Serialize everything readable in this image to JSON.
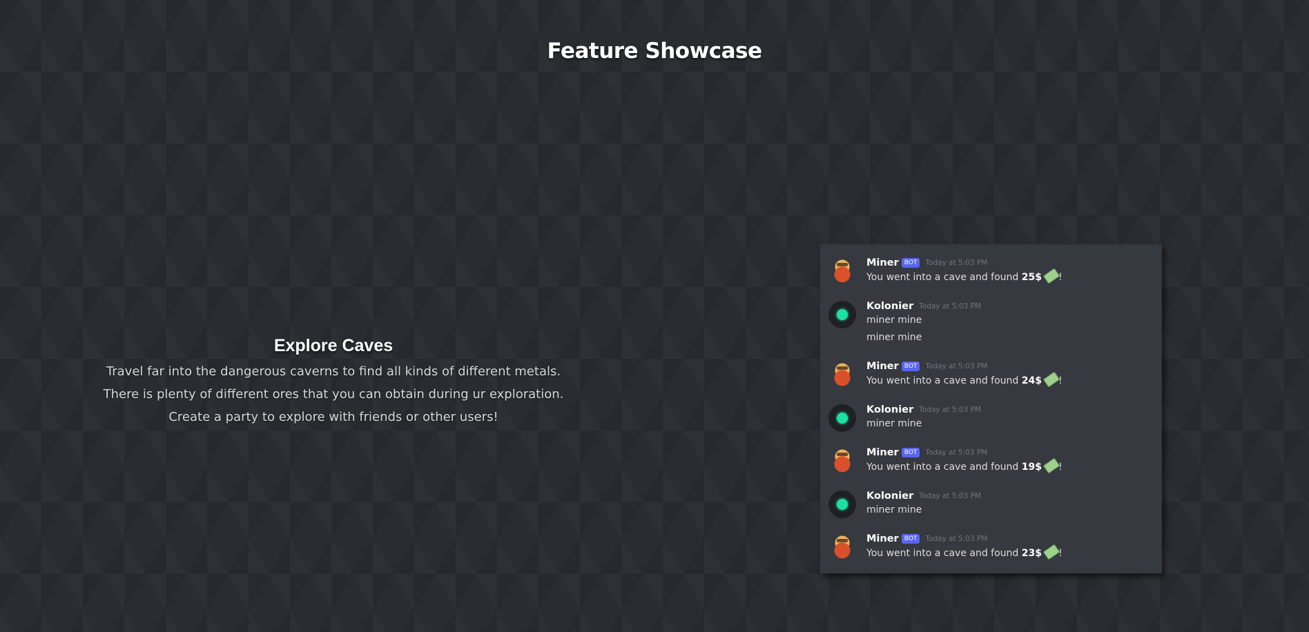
{
  "page": {
    "title": "Feature Showcase"
  },
  "feature": {
    "title": "Explore Caves",
    "lines": [
      "Travel far into the dangerous caverns to find all kinds of different metals.",
      "There is plenty of different ores that you can obtain during ur exploration.",
      "Create a party to explore with friends or other users!"
    ]
  },
  "chat": {
    "messages": [
      {
        "username": "Miner",
        "tag": "BOT",
        "time": "Today at 5:03 PM",
        "prefix": "You went into a cave and found ",
        "amount": "25$",
        "suffix": "!"
      },
      {
        "username": "Kolonier",
        "time": "Today at 5:03 PM",
        "line1": "miner mine",
        "line2": "miner mine"
      },
      {
        "username": "Miner",
        "tag": "BOT",
        "time": "Today at 5:03 PM",
        "prefix": "You went into a cave and found ",
        "amount": "24$",
        "suffix": "!"
      },
      {
        "username": "Kolonier",
        "time": "Today at 5:03 PM",
        "line1": "miner mine"
      },
      {
        "username": "Miner",
        "tag": "BOT",
        "time": "Today at 5:03 PM",
        "prefix": "You went into a cave and found ",
        "amount": "19$",
        "suffix": "!"
      },
      {
        "username": "Kolonier",
        "time": "Today at 5:03 PM",
        "line1": "miner mine"
      },
      {
        "username": "Miner",
        "tag": "BOT",
        "time": "Today at 5:03 PM",
        "prefix": "You went into a cave and found ",
        "amount": "23$",
        "suffix": "!"
      }
    ]
  },
  "colors": {
    "background": "#2a2c31",
    "panel": "#36393f",
    "bot_tag": "#5865f2",
    "online_dot": "#1de0a0"
  },
  "icons": {
    "bot_avatar": "miner-avatar-icon",
    "user_avatar": "green-dot-avatar-icon",
    "money": "money-wings-icon"
  }
}
